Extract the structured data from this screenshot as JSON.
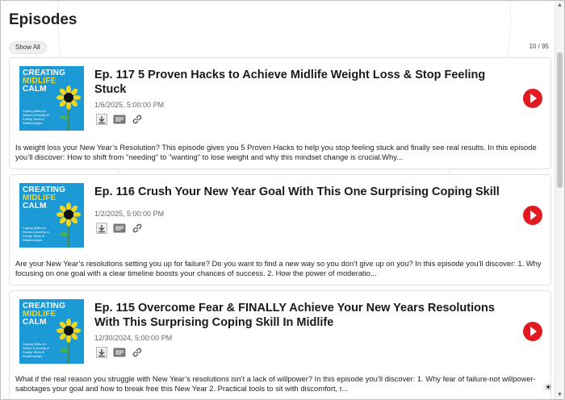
{
  "page": {
    "title": "Episodes",
    "show_all_label": "Show All",
    "episode_count": "10 / 95"
  },
  "artwork": {
    "line1": "CREATING",
    "line2": "MIDLIFE",
    "line3": "CALM",
    "tagline": "Coping Skills for Stress & Anxiety in Family, Work & Relationships",
    "colors": {
      "background": "#1c9ad6",
      "accent": "#f2d51c"
    }
  },
  "episodes": [
    {
      "title": "Ep. 117 5 Proven Hacks to Achieve Midlife Weight Loss & Stop Feeling Stuck",
      "date": "1/6/2025, 5:00:00 PM",
      "description": "Is weight loss your New Year’s Resolution? This episode gives you 5 Proven Hacks to help you stop feeling stuck and finally see real results. In this episode you’ll discover:  How to shift from \"needing\" to \"wanting\" to lose weight and why this mindset change is crucial.Why..."
    },
    {
      "title": "Ep. 116 Crush Your New Year Goal With This One Surprising Coping Skill",
      "date": "1/2/2025, 5:00:00 PM",
      "description": "Are your New Year’s resolutions setting you up for failure? Do you want to  find a new way so you don’t give up on you?  In this episode you’ll discover: 1. Why focusing on one goal with a clear timeline boosts your chances of success. 2. How the power of moderatio..."
    },
    {
      "title": "Ep. 115 Overcome Fear & FINALLY Achieve Your New Years Resolutions With This Surprising Coping Skill In Midlife",
      "date": "12/30/2024, 5:00:00 PM",
      "description": "What if the real reason you struggle with New Year’s resolutions isn’t a lack of willpower?  In this episode you’ll discover: 1. Why fear of failure-not willpower- sabotages your goal and how to break free this New  Year 2. Practical tools to sit with discomfort, r..."
    }
  ],
  "icons": [
    "download-icon",
    "transcript-icon",
    "link-icon",
    "play-icon",
    "theme-toggle-icon"
  ],
  "colors": {
    "play": "#e01b22",
    "title": "#1a1a1a",
    "muted": "#666666"
  }
}
